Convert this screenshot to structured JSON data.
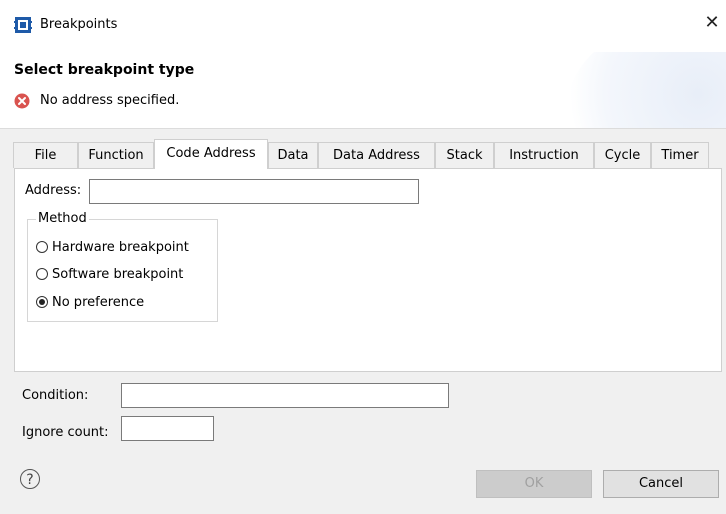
{
  "window": {
    "title": "Breakpoints",
    "close_glyph": "✕"
  },
  "header": {
    "title": "Select breakpoint type",
    "error_message": "No address specified.",
    "error_icon": "error-icon"
  },
  "tabs": [
    {
      "label": "File"
    },
    {
      "label": "Function"
    },
    {
      "label": "Code Address",
      "active": true
    },
    {
      "label": "Data"
    },
    {
      "label": "Data Address"
    },
    {
      "label": "Stack"
    },
    {
      "label": "Instruction"
    },
    {
      "label": "Cycle"
    },
    {
      "label": "Timer"
    }
  ],
  "panel": {
    "address_label": "Address:",
    "address_value": "",
    "method_group_title": "Method",
    "methods": [
      {
        "label": "Hardware breakpoint",
        "checked": false
      },
      {
        "label": "Software breakpoint",
        "checked": false
      },
      {
        "label": "No preference",
        "checked": true
      }
    ]
  },
  "condition": {
    "label": "Condition:",
    "value": ""
  },
  "ignore_count": {
    "label": "Ignore count:",
    "value": ""
  },
  "footer": {
    "help_glyph": "?",
    "ok_label": "OK",
    "ok_enabled": false,
    "cancel_label": "Cancel"
  },
  "colors": {
    "error_red": "#d9534f",
    "ok_disabled_bg": "#cccccc"
  }
}
